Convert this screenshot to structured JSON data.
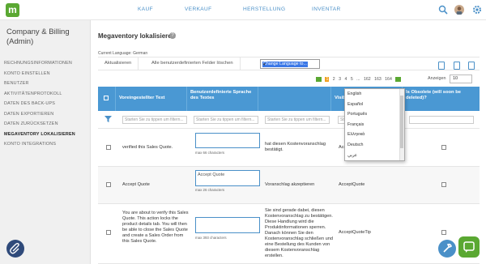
{
  "nav": {
    "logo_letter": "m",
    "items": [
      "KAUF",
      "VERKAUF",
      "HERSTELLUNG",
      "INVENTAR"
    ]
  },
  "sidebar": {
    "title": "Company & Billing (Admin)",
    "items": [
      {
        "label": "RECHNUNGSINFORMATIONEN",
        "active": false
      },
      {
        "label": "KONTO EINSTELLEN",
        "active": false
      },
      {
        "label": "BENUTZER",
        "active": false
      },
      {
        "label": "AKTIVITÄTENPROTOKOLL",
        "active": false
      },
      {
        "label": "DATEN DES BACK-UPS",
        "active": false
      },
      {
        "label": "DATEN EXPORTIEREN",
        "active": false
      },
      {
        "label": "DATEN ZURÜCKSETZEN",
        "active": false
      },
      {
        "label": "MEGAVENTORY LOKALISIEREN",
        "active": true
      },
      {
        "label": "KONTO INTEGRATIONS",
        "active": false
      }
    ]
  },
  "main": {
    "title": "Megaventory lokalisieren",
    "current_language": "Current Language: German",
    "toolbar": {
      "update": "Aktualisieren",
      "clear": "Alle benutzerdefinierten Felder löschen",
      "lang_select": "Change Language to..."
    },
    "language_options": [
      "English",
      "Español",
      "Português",
      "Français",
      "Ελληνικά",
      "Deutsch",
      "عربي"
    ],
    "pager": {
      "pages": [
        "1",
        "2",
        "3",
        "4",
        "5",
        "...",
        "162",
        "163",
        "164"
      ],
      "selected": "1",
      "show_label": "Anzeigen",
      "show_value": "10"
    },
    "columns": [
      "Voreingestellter Text",
      "Benutzerdefinierte Sprache des Textes",
      "",
      "Visible in Test Site only",
      "Is Obsolete (will soon be deleted)?"
    ],
    "filter_placeholder": "Starten Sie zu tippen um filtern...",
    "rows": [
      {
        "default_text": "verified this Sales Quote.",
        "custom_text": "",
        "max_chars": "max 66 characters",
        "translation": "hat diesen Kostenvoranschlag bestätigt.",
        "key": "AcceptedThisSQ"
      },
      {
        "default_text": "Accept Quote",
        "custom_text": "Accept Quote",
        "max_chars": "max 26 characters",
        "translation": "Voranschlag akzeptieren",
        "key": "AcceptQuote"
      },
      {
        "default_text": "You are about to verify this Sales Quote. This action locks the product details tab. You will then be able to close the Sales Quote and create a Sales Order from this Sales Quote.",
        "custom_text": "",
        "max_chars": "max 393 characters",
        "translation": "Sie sind gerade dabei, diesen Kostenvoranschlag zu bestätigen. Diese Handlung wird die Produktinformationen sperren. Danach können Sie den Kostenvoranschlag schließen und eine Bestellung des Kunden von diesem Kostenvoranschlag erstellen.",
        "key": "AcceptQuoteTip"
      }
    ]
  }
}
